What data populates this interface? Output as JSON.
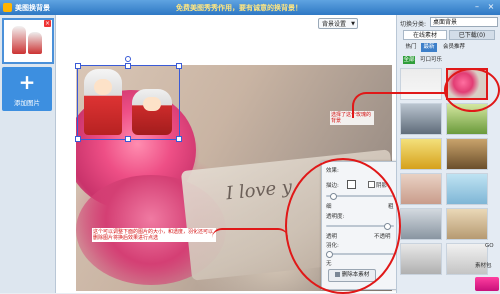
{
  "window": {
    "title": "美图换背景",
    "promo_text": "免费美图秀秀作用，要有诚意的换背景！",
    "minimize": "–",
    "close": "×"
  },
  "left_panel": {
    "add_button_plus": "+",
    "add_button_label": "添加图片",
    "thumb_close": "×"
  },
  "canvas": {
    "bg_setting_label": "背景设置",
    "love_text": "I love y",
    "note_right": "选择了这个玫瑰的背景",
    "note_bottom": "这个可以调整下面的图片的大小，和透度，羽化还可以删除图片将换后效果进行点选"
  },
  "props_panel": {
    "title": "效果:",
    "border_label": "描边:",
    "shadow_label": "阴影",
    "thin_label": "细",
    "thick_label": "粗",
    "opacity_label": "透明度:",
    "transparent_label": "透明",
    "opaque_label": "不透明",
    "feather_label": "羽化:",
    "none_label": "无",
    "delete_button": "删除本素材"
  },
  "right_panel": {
    "switch_label": "切换分类:",
    "category_value": "桌面背景",
    "tab_online": "在线素材",
    "tab_downloaded": "已下载(0)",
    "sub_hot": "热门",
    "sub_new": "最新",
    "sub_vip": "会员推荐",
    "filter_all": "全部",
    "filter_cute": "可口可乐",
    "go_label": "GO",
    "material_label": "素材包"
  }
}
